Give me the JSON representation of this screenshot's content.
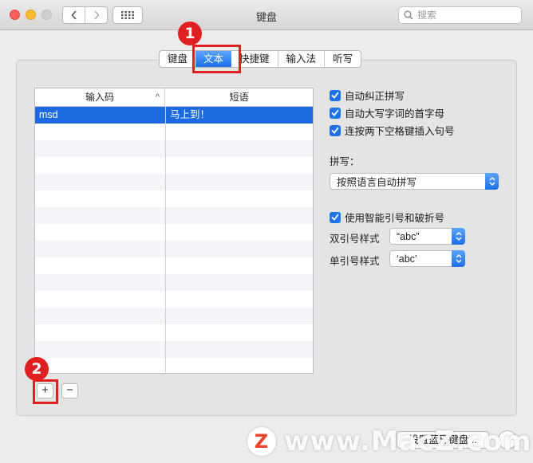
{
  "window": {
    "title": "键盘",
    "search_placeholder": "搜索"
  },
  "tabs": [
    {
      "label": "键盘",
      "active": false
    },
    {
      "label": "文本",
      "active": true
    },
    {
      "label": "快捷键",
      "active": false
    },
    {
      "label": "输入法",
      "active": false
    },
    {
      "label": "听写",
      "active": false
    }
  ],
  "table": {
    "columns": [
      "输入码",
      "短语"
    ],
    "rows": [
      {
        "code": "msd",
        "phrase": "马上到！",
        "selected": true
      }
    ]
  },
  "list_buttons": {
    "add": "+",
    "remove": "−"
  },
  "options": {
    "auto_correct": {
      "label": "自动纠正拼写",
      "checked": true
    },
    "auto_capitalize": {
      "label": "自动大写字词的首字母",
      "checked": true
    },
    "double_space_period": {
      "label": "连按两下空格键插入句号",
      "checked": true
    },
    "spelling_label": "拼写：",
    "spelling_value": "按照语言自动拼写",
    "smart_quotes": {
      "label": "使用智能引号和破折号",
      "checked": true
    },
    "double_quotes_label": "双引号样式",
    "double_quotes_value": "“abc”",
    "single_quotes_label": "单引号样式",
    "single_quotes_value": "‘abc’"
  },
  "bottom": {
    "bluetooth_button": "设置蓝牙键盘...",
    "help": "?"
  },
  "annotations": {
    "step1": "1",
    "step2": "2"
  },
  "watermark": {
    "logo": "Z",
    "text": "www.MacZ.com"
  },
  "colors": {
    "accent": "#1d70e8",
    "annotation": "#e02020",
    "selection": "#1b6adf"
  }
}
